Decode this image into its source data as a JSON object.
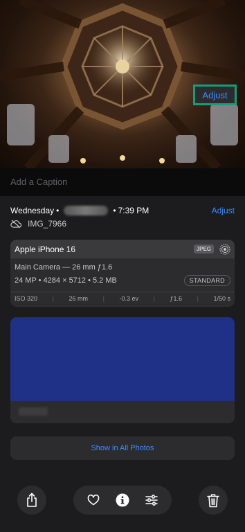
{
  "caption": {
    "placeholder": "Add a Caption"
  },
  "metadata": {
    "day": "Wednesday",
    "bullet": "•",
    "time": "7:39 PM",
    "adjust_label": "Adjust",
    "filename": "IMG_7966"
  },
  "camera_card": {
    "device": "Apple iPhone 16",
    "format_badge": "JPEG",
    "lens": "Main Camera — 26 mm ƒ1.6",
    "specs": "24 MP • 4284 × 5712 • 5.2 MB",
    "style_badge": "STANDARD",
    "exif": [
      "ISO 320",
      "26 mm",
      "-0.3 ev",
      "ƒ1.6",
      "1/50 s"
    ]
  },
  "map": {
    "adjust_label": "Adjust"
  },
  "show_all_label": "Show in All Photos",
  "toolbar": {
    "share_icon": "share-icon",
    "favorite_icon": "heart-icon",
    "info_icon": "info-icon",
    "edit_icon": "sliders-icon",
    "delete_icon": "trash-icon"
  },
  "colors": {
    "background": "#1c1c1e",
    "card": "#2c2c2e",
    "accent": "#3b8cff",
    "redaction": "#1f3087",
    "highlight": "#169c7a"
  }
}
